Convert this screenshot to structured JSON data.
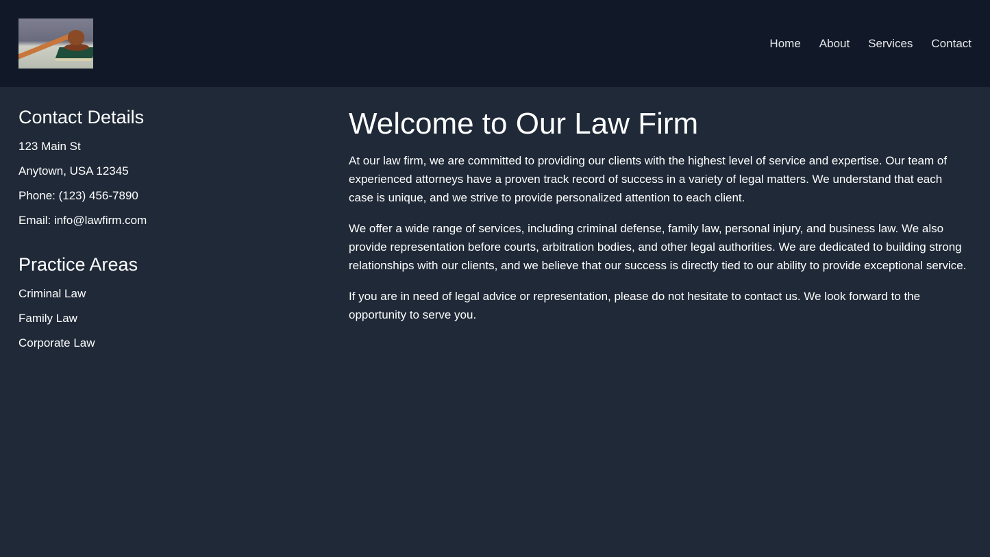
{
  "header": {
    "logo_alt": "Gavel on a green book over dollar bills",
    "nav": [
      {
        "label": "Home"
      },
      {
        "label": "About"
      },
      {
        "label": "Services"
      },
      {
        "label": "Contact"
      }
    ]
  },
  "sidebar": {
    "contact": {
      "title": "Contact Details",
      "lines": [
        "123 Main St",
        "Anytown, USA 12345",
        "Phone: (123) 456-7890",
        "Email: info@lawfirm.com"
      ]
    },
    "practice": {
      "title": "Practice Areas",
      "items": [
        "Criminal Law",
        "Family Law",
        "Corporate Law"
      ]
    }
  },
  "content": {
    "title": "Welcome to Our Law Firm",
    "paragraphs": [
      "At our law firm, we are committed to providing our clients with the highest level of service and expertise. Our team of experienced attorneys have a proven track record of success in a variety of legal matters. We understand that each case is unique, and we strive to provide personalized attention to each client.",
      "We offer a wide range of services, including criminal defense, family law, personal injury, and business law. We also provide representation before courts, arbitration bodies, and other legal authorities. We are dedicated to building strong relationships with our clients, and we believe that our success is directly tied to our ability to provide exceptional service.",
      "If you are in need of legal advice or representation, please do not hesitate to contact us. We look forward to the opportunity to serve you."
    ]
  },
  "colors": {
    "header_bg": "#111827",
    "page_bg": "#1f2937",
    "text": "#ffffff",
    "nav_text": "#e5e7eb"
  }
}
